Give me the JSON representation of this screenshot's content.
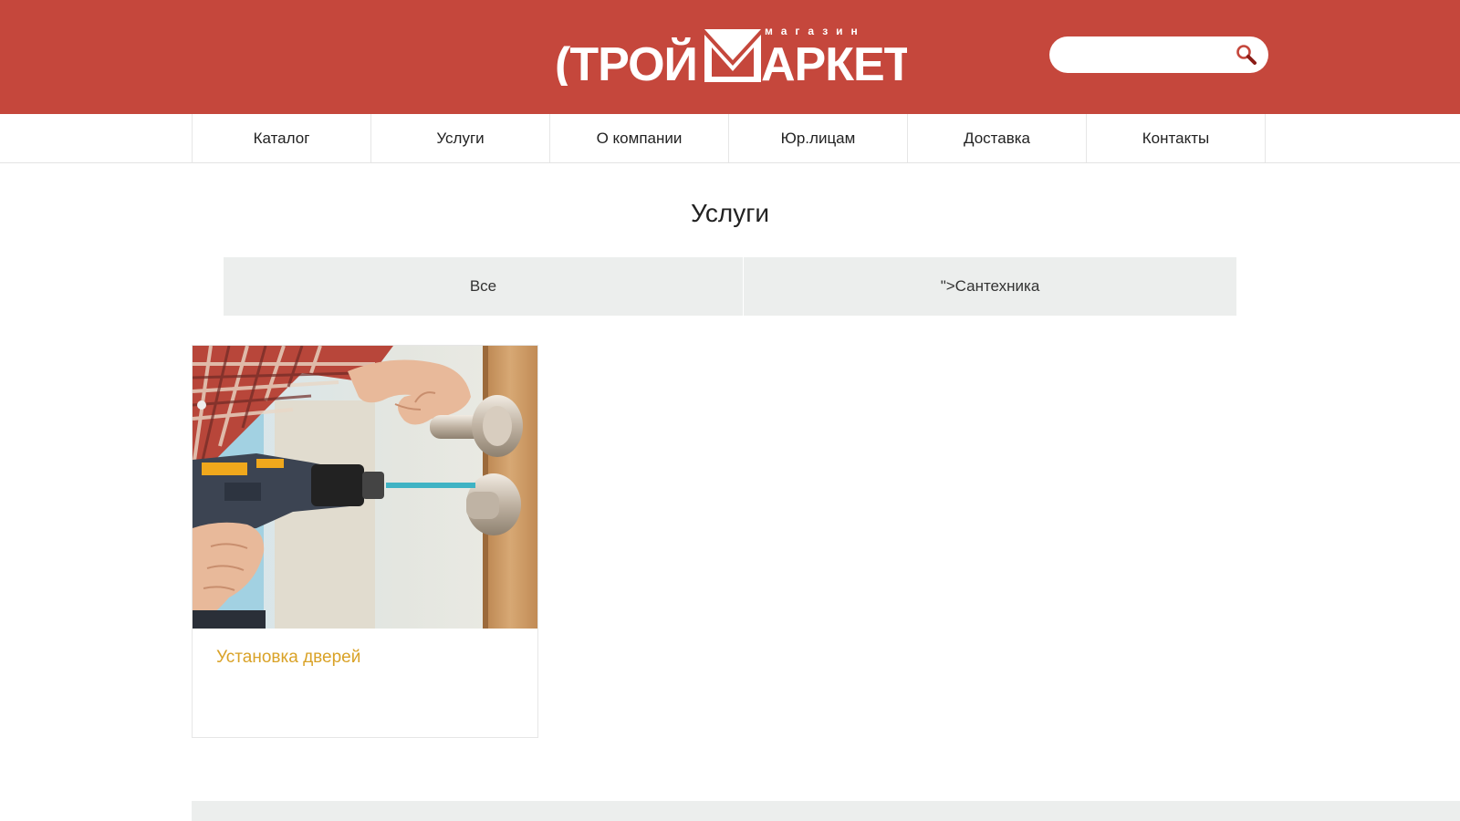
{
  "brand": {
    "logo_small": "магазин",
    "logo_main": "(ТРОЙ",
    "logo_main_2": "АРКЕТ",
    "primary_color": "#c5473c",
    "accent_color": "#d9a227"
  },
  "search": {
    "placeholder": "",
    "icon": "search-icon"
  },
  "nav": {
    "items": [
      {
        "label": "Каталог"
      },
      {
        "label": "Услуги"
      },
      {
        "label": "О компании"
      },
      {
        "label": "Юр.лицам"
      },
      {
        "label": "Доставка"
      },
      {
        "label": "Контакты"
      }
    ]
  },
  "main": {
    "title": "Услуги",
    "filters": [
      {
        "label": "Все"
      },
      {
        "label": "\">Сантехника"
      }
    ],
    "cards": [
      {
        "title": "Установка дверей",
        "image": "door-installation-photo"
      }
    ]
  }
}
